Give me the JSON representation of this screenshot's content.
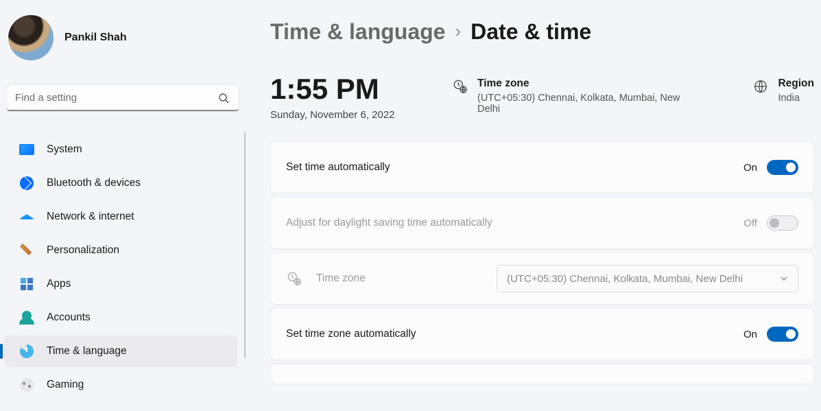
{
  "profile": {
    "name": "Pankil Shah"
  },
  "search": {
    "placeholder": "Find a setting"
  },
  "nav": [
    {
      "id": "system",
      "label": "System"
    },
    {
      "id": "bluetooth",
      "label": "Bluetooth & devices"
    },
    {
      "id": "network",
      "label": "Network & internet"
    },
    {
      "id": "personal",
      "label": "Personalization"
    },
    {
      "id": "apps",
      "label": "Apps"
    },
    {
      "id": "accounts",
      "label": "Accounts"
    },
    {
      "id": "timelang",
      "label": "Time & language"
    },
    {
      "id": "gaming",
      "label": "Gaming"
    }
  ],
  "breadcrumb": {
    "parent": "Time & language",
    "current": "Date & time"
  },
  "summary": {
    "time": "1:55 PM",
    "date": "Sunday, November 6, 2022",
    "tz_title": "Time zone",
    "tz_desc": "(UTC+05:30) Chennai, Kolkata, Mumbai, New Delhi",
    "region_title": "Region",
    "region_desc": "India"
  },
  "cards": {
    "set_time_auto": {
      "label": "Set time automatically",
      "state_label": "On"
    },
    "dst_auto": {
      "label": "Adjust for daylight saving time automatically",
      "state_label": "Off"
    },
    "tz_row": {
      "label": "Time zone",
      "value": "(UTC+05:30) Chennai, Kolkata, Mumbai, New Delhi"
    },
    "set_tz_auto": {
      "label": "Set time zone automatically",
      "state_label": "On"
    }
  }
}
